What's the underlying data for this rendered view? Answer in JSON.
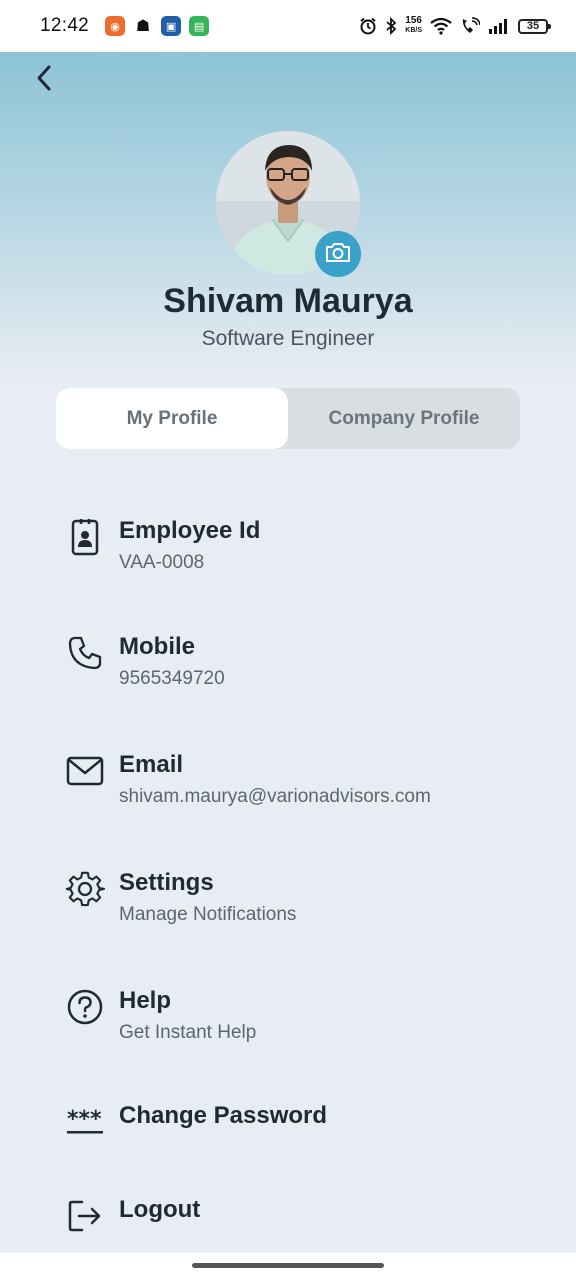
{
  "status_bar": {
    "time": "12:42",
    "net_speed_value": "156",
    "net_speed_unit": "KB/S",
    "battery": "35"
  },
  "header": {
    "back_icon": "chevron-left-icon",
    "gradient_top": "#8cc3d6"
  },
  "profile": {
    "name": "Shivam Maurya",
    "role": "Software Engineer",
    "camera_icon": "camera-icon",
    "accent": "#3aa1c9"
  },
  "tabs": [
    {
      "label": "My Profile",
      "active": true
    },
    {
      "label": "Company Profile",
      "active": false
    }
  ],
  "items": [
    {
      "icon": "id-badge-icon",
      "title": "Employee Id",
      "subtitle": "VAA-0008"
    },
    {
      "icon": "phone-icon",
      "title": "Mobile",
      "subtitle": "9565349720"
    },
    {
      "icon": "mail-icon",
      "title": "Email",
      "subtitle": "shivam.maurya@varionadvisors.com"
    },
    {
      "icon": "gear-icon",
      "title": "Settings",
      "subtitle": "Manage Notifications"
    },
    {
      "icon": "help-icon",
      "title": "Help",
      "subtitle": "Get Instant Help"
    },
    {
      "icon": "password-icon",
      "title": "Change Password",
      "subtitle": ""
    },
    {
      "icon": "logout-icon",
      "title": "Logout",
      "subtitle": ""
    }
  ]
}
